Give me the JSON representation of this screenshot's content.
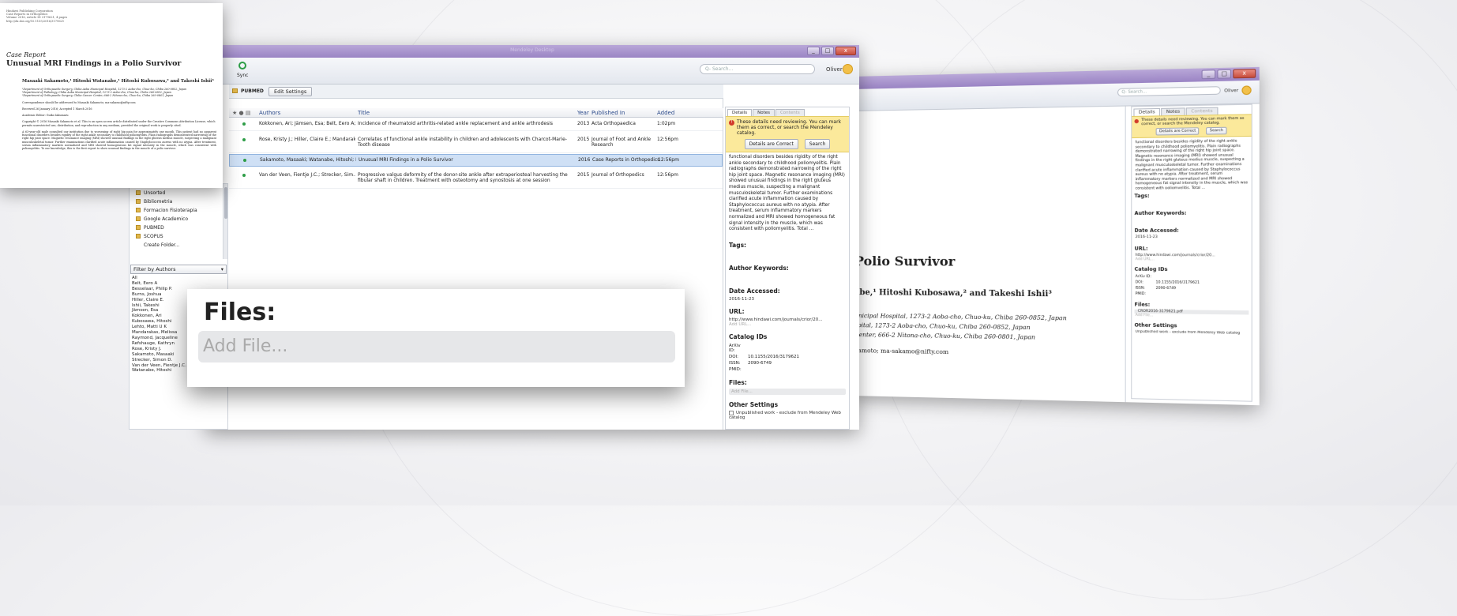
{
  "main_window": {
    "title": "Mendeley Desktop",
    "toolbar": {
      "sync_label": "Sync",
      "search_placeholder": "Q- Search...",
      "user_name": "Oliver"
    },
    "folder_header": "PUBMED",
    "edit_settings": "Edit Settings",
    "columns": {
      "authors": "Authors",
      "title": "Title",
      "year": "Year",
      "published_in": "Published In",
      "added": "Added"
    },
    "rows": [
      {
        "authors": "Kokkonen, Ari; Jämsen, Esa; Belt, Eero A; ...",
        "title": "Incidence of rheumatoid arthritis-related ankle replacement and ankle arthrodesis",
        "year": "2013",
        "published_in": "Acta Orthopaedica",
        "added": "1:02pm"
      },
      {
        "authors": "Rose, Kristy J.; Hiller, Claire E.; Mandaraki...",
        "title": "Correlates of functional ankle instability in children and adolescents with Charcot-Marie-Tooth disease",
        "year": "2015",
        "published_in": "Journal of Foot and Ankle Research",
        "added": "12:56pm"
      },
      {
        "authors": "Sakamoto, Masaaki; Watanabe, Hitoshi; K...",
        "title": "Unusual MRI Findings in a Polio Survivor",
        "year": "2016",
        "published_in": "Case Reports in Orthopedics",
        "added": "12:56pm"
      },
      {
        "authors": "Van der Veen, Fientje J.C.; Strecker, Sim...",
        "title": "Progressive valgus deformity of the donor-site ankle after extraperiosteal harvesting the fibular shaft in children. Treatment with osteotomy and synostosis at one session",
        "year": "2015",
        "published_in": "Journal of Orthopedics",
        "added": "12:56pm"
      }
    ],
    "folders": [
      "Unsorted",
      "Bibliometria",
      "Formacion Fisioterapia",
      "Google Academico",
      "PUBMED",
      "SCOPUS",
      "Create Folder..."
    ],
    "filter_label": "Filter by Authors",
    "authors_filter": [
      "All",
      "Belt, Eero A",
      "Besselaar, Philip P.",
      "Burns, Joshua",
      "Hiller, Claire E.",
      "Ishii, Takeshi",
      "Jämsen, Esa",
      "Kokkonen, Ari",
      "Kubosawa, Hitoshi",
      "Lehto, Matti U K",
      "Mandarakas, Melissa",
      "Raymond, Jacqueline",
      "Refshauge, Kathryn",
      "Rose, Kristy J.",
      "Sakamoto, Masaaki",
      "Strecker, Simon D.",
      "Van der Veen, Fientje J.C.",
      "Watanabe, Hitoshi"
    ]
  },
  "details": {
    "tabs": [
      "Details",
      "Notes",
      "Contents"
    ],
    "warning": "These details need reviewing. You can mark them as correct, or search the Mendeley catalog.",
    "btn_correct": "Details are Correct",
    "btn_search": "Search",
    "abstract": "functional disorders besides rigidity of the right ankle secondary to childhood poliomyelitis. Plain radiographs demonstrated narrowing of the right hip joint space. Magnetic resonance imaging (MRI) showed unusual findings in the right gluteus medius muscle, suspecting a malignant musculoskeletal tumor. Further examinations clarified acute inflammation caused by Staphylococcus aureus with no atypia. After treatment, serum inflammatory markers normalized and MRI showed homogeneous fat signal intensity in the muscle, which was consistent with poliomyelitis. Total ...",
    "tags_label": "Tags:",
    "keywords_label": "Author Keywords:",
    "date_label": "Date Accessed:",
    "date_value": "2016-11-23",
    "url_label": "URL:",
    "url_value": "http://www.hindawi.com/journals/crior/20...",
    "add_url": "Add URL...",
    "catalog_label": "Catalog IDs",
    "arxiv": "ArXiv ID:",
    "doi": "DOI:",
    "doi_value": "10.1155/2016/3179621",
    "issn": "ISSN:",
    "issn_value": "2090-6749",
    "pmid": "PMID:",
    "files_label": "Files:",
    "add_file": "Add File...",
    "file_name": "CROR2016-3179621.pdf",
    "other_label": "Other Settings",
    "unpublished": "Unpublished work - exclude from Mendeley Web catalog"
  },
  "paper": {
    "header_lines": [
      "Hindawi Publishing Corporation",
      "Case Reports in Orthopedics",
      "Volume 2016, Article ID 3179621, 4 pages",
      "http://dx.doi.org/10.1155/2016/3179621"
    ],
    "kind": "Case Report",
    "title": "Unusual MRI Findings in a Polio Survivor",
    "authors": "Masaaki Sakamoto,¹ Hitoshi Watanabe,¹ Hitoshi Kubosawa,² and Takeshi Ishii³",
    "affiliations": [
      "¹Department of Orthopaedic Surgery, Chiba Aoba Municipal Hospital, 1273-2 Aoba-cho, Chuo-ku, Chiba 260-0852, Japan",
      "²Department of Pathology, Chiba Aoba Municipal Hospital, 1273-2 Aoba-cho, Chuo-ku, Chiba 260-0852, Japan",
      "³Department of Orthopaedic Surgery, Chiba Cancer Center, 666-2 Nitona-cho, Chuo-ku, Chiba 260-0801, Japan"
    ],
    "correspondence": "Correspondence should be addressed to Masaaki Sakamoto; ma-sakamo@nifty.com",
    "received": "Received 26 January 2016; Accepted 1 March 2016",
    "editor": "Academic Editor: Guiko Iakumaru",
    "copyright": "Copyright © 2016 Masaaki Sakamoto et al. This is an open access article distributed under the Creative Commons Attribution License, which permits unrestricted use, distribution, and reproduction in any medium, provided the original work is properly cited.",
    "body": "A 63-year-old male consulted our institution due to worsening of right hip pain for approximately one month. This patient had no apparent functional disorders besides rigidity of the right ankle secondary to childhood poliomyelitis. Plain radiographs demonstrated narrowing of the right hip joint space. Magnetic resonance imaging (MRI) showed unusual findings in the right gluteus medius muscle, suspecting a malignant musculoskeletal tumor. Further examinations clarified acute inflammation caused by Staphylococcus aureus with no atypia. After treatment, serum inflammatory markers normalized and MRI showed homogeneous fat signal intensity in the muscle, which was consistent with poliomyelitis. To our knowledge, this is the first report to show unusual findings in the muscle of a polio survivor."
  },
  "zoom": {
    "files_label": "Files:",
    "add_file": "Add File..."
  },
  "right_doc": {
    "title": "Polio Survivor",
    "authors": "abe,¹ Hitoshi Kubosawa,² and Takeshi Ishii³",
    "aff1": "unicipal Hospital, 1273-2 Aoba-cho, Chuo-ku, Chiba 260-0852, Japan",
    "aff2": "spital, 1273-2 Aoba-cho, Chuo-ku, Chiba 260-0852, Japan",
    "aff3": "Center, 666-2 Nitona-cho, Chuo-ku, Chiba 260-0801, Japan",
    "email": "kamoto; ma-sakamo@nifty.com"
  }
}
